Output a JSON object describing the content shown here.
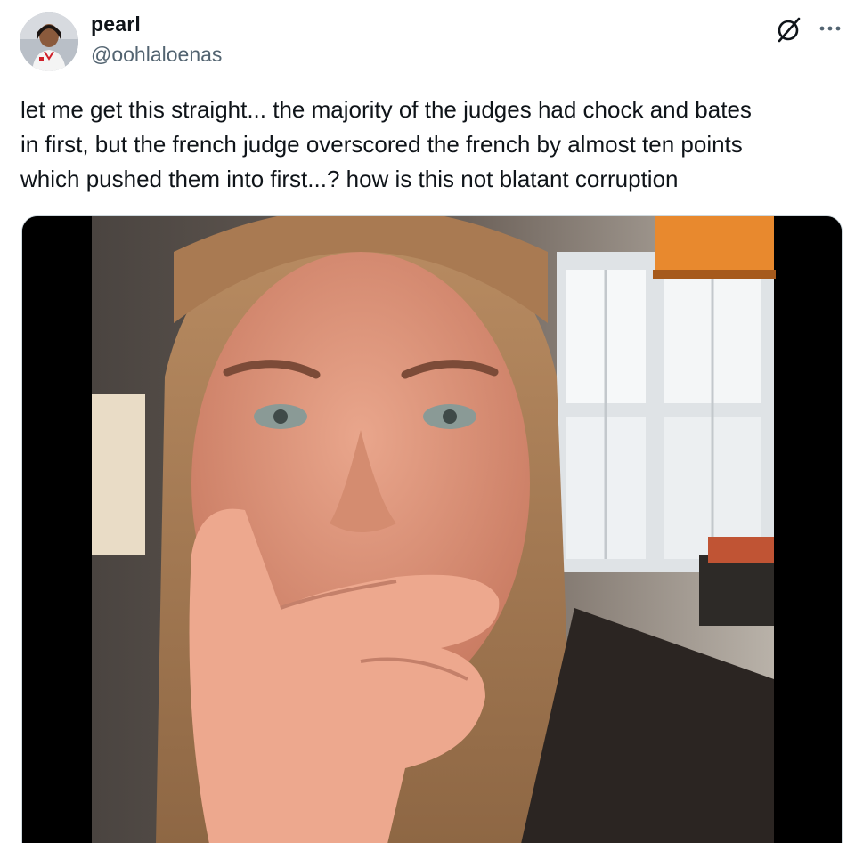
{
  "author": {
    "name": "pearl",
    "handle": "@oohlaloenas",
    "avatar_icon": "profile-photo"
  },
  "header_actions": {
    "grok_icon": "grok-slash-circle-icon",
    "more_icon": "more-horizontal-icon"
  },
  "tweet": {
    "text": "let me get this straight... the majority of the judges had chock and bates\nin first, but the french judge overscored the french by almost ten points\nwhich pushed them into first...? how is this not blatant corruption"
  },
  "media": {
    "kind": "video-gif",
    "description_icon": "video-thumbnail"
  },
  "colors": {
    "text_primary": "#0f1419",
    "text_secondary": "#536471",
    "border": "#cfd9de"
  }
}
